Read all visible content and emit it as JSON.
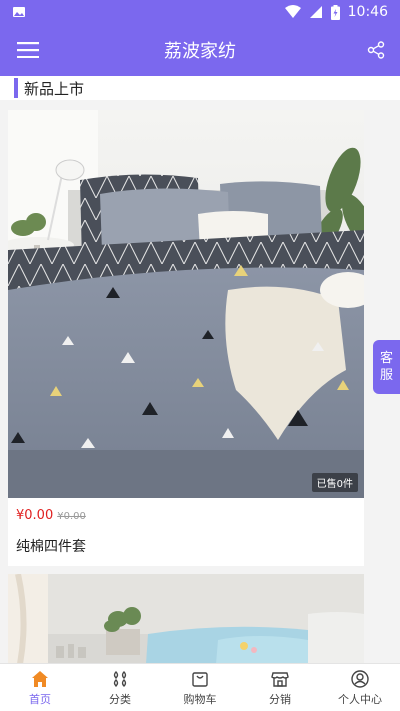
{
  "status_bar": {
    "time": "10:46"
  },
  "app_bar": {
    "title": "荔波家纺"
  },
  "section": {
    "title": "新品上市"
  },
  "products": [
    {
      "price": "¥0.00",
      "original_price": "¥0.00",
      "sold": "已售0件",
      "name": "纯棉四件套"
    }
  ],
  "service_tab": {
    "line1": "客",
    "line2": "服"
  },
  "bottom_nav": [
    {
      "label": "首页",
      "icon": "home-icon",
      "active": true
    },
    {
      "label": "分类",
      "icon": "category-icon",
      "active": false
    },
    {
      "label": "购物车",
      "icon": "cart-icon",
      "active": false
    },
    {
      "label": "分销",
      "icon": "store-icon",
      "active": false
    },
    {
      "label": "个人中心",
      "icon": "user-icon",
      "active": false
    }
  ],
  "colors": {
    "primary": "#7b68ee",
    "price": "#e02020",
    "background": "#f3f3f3"
  }
}
